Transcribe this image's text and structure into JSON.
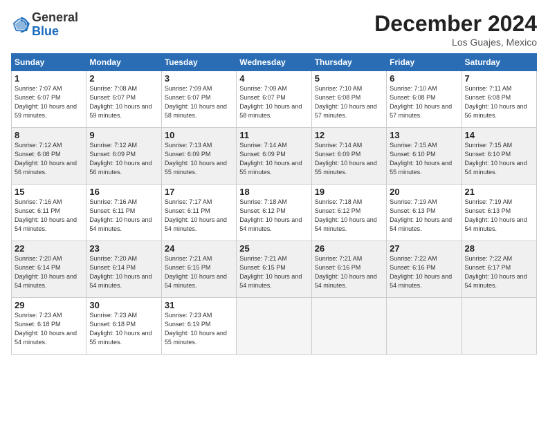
{
  "logo": {
    "general": "General",
    "blue": "Blue"
  },
  "title": "December 2024",
  "location": "Los Guajes, Mexico",
  "headers": [
    "Sunday",
    "Monday",
    "Tuesday",
    "Wednesday",
    "Thursday",
    "Friday",
    "Saturday"
  ],
  "weeks": [
    [
      {
        "day": "1",
        "sunrise": "7:07 AM",
        "sunset": "6:07 PM",
        "daylight": "10 hours and 59 minutes."
      },
      {
        "day": "2",
        "sunrise": "7:08 AM",
        "sunset": "6:07 PM",
        "daylight": "10 hours and 59 minutes."
      },
      {
        "day": "3",
        "sunrise": "7:09 AM",
        "sunset": "6:07 PM",
        "daylight": "10 hours and 58 minutes."
      },
      {
        "day": "4",
        "sunrise": "7:09 AM",
        "sunset": "6:07 PM",
        "daylight": "10 hours and 58 minutes."
      },
      {
        "day": "5",
        "sunrise": "7:10 AM",
        "sunset": "6:08 PM",
        "daylight": "10 hours and 57 minutes."
      },
      {
        "day": "6",
        "sunrise": "7:10 AM",
        "sunset": "6:08 PM",
        "daylight": "10 hours and 57 minutes."
      },
      {
        "day": "7",
        "sunrise": "7:11 AM",
        "sunset": "6:08 PM",
        "daylight": "10 hours and 56 minutes."
      }
    ],
    [
      {
        "day": "8",
        "sunrise": "7:12 AM",
        "sunset": "6:08 PM",
        "daylight": "10 hours and 56 minutes."
      },
      {
        "day": "9",
        "sunrise": "7:12 AM",
        "sunset": "6:09 PM",
        "daylight": "10 hours and 56 minutes."
      },
      {
        "day": "10",
        "sunrise": "7:13 AM",
        "sunset": "6:09 PM",
        "daylight": "10 hours and 55 minutes."
      },
      {
        "day": "11",
        "sunrise": "7:14 AM",
        "sunset": "6:09 PM",
        "daylight": "10 hours and 55 minutes."
      },
      {
        "day": "12",
        "sunrise": "7:14 AM",
        "sunset": "6:09 PM",
        "daylight": "10 hours and 55 minutes."
      },
      {
        "day": "13",
        "sunrise": "7:15 AM",
        "sunset": "6:10 PM",
        "daylight": "10 hours and 55 minutes."
      },
      {
        "day": "14",
        "sunrise": "7:15 AM",
        "sunset": "6:10 PM",
        "daylight": "10 hours and 54 minutes."
      }
    ],
    [
      {
        "day": "15",
        "sunrise": "7:16 AM",
        "sunset": "6:11 PM",
        "daylight": "10 hours and 54 minutes."
      },
      {
        "day": "16",
        "sunrise": "7:16 AM",
        "sunset": "6:11 PM",
        "daylight": "10 hours and 54 minutes."
      },
      {
        "day": "17",
        "sunrise": "7:17 AM",
        "sunset": "6:11 PM",
        "daylight": "10 hours and 54 minutes."
      },
      {
        "day": "18",
        "sunrise": "7:18 AM",
        "sunset": "6:12 PM",
        "daylight": "10 hours and 54 minutes."
      },
      {
        "day": "19",
        "sunrise": "7:18 AM",
        "sunset": "6:12 PM",
        "daylight": "10 hours and 54 minutes."
      },
      {
        "day": "20",
        "sunrise": "7:19 AM",
        "sunset": "6:13 PM",
        "daylight": "10 hours and 54 minutes."
      },
      {
        "day": "21",
        "sunrise": "7:19 AM",
        "sunset": "6:13 PM",
        "daylight": "10 hours and 54 minutes."
      }
    ],
    [
      {
        "day": "22",
        "sunrise": "7:20 AM",
        "sunset": "6:14 PM",
        "daylight": "10 hours and 54 minutes."
      },
      {
        "day": "23",
        "sunrise": "7:20 AM",
        "sunset": "6:14 PM",
        "daylight": "10 hours and 54 minutes."
      },
      {
        "day": "24",
        "sunrise": "7:21 AM",
        "sunset": "6:15 PM",
        "daylight": "10 hours and 54 minutes."
      },
      {
        "day": "25",
        "sunrise": "7:21 AM",
        "sunset": "6:15 PM",
        "daylight": "10 hours and 54 minutes."
      },
      {
        "day": "26",
        "sunrise": "7:21 AM",
        "sunset": "6:16 PM",
        "daylight": "10 hours and 54 minutes."
      },
      {
        "day": "27",
        "sunrise": "7:22 AM",
        "sunset": "6:16 PM",
        "daylight": "10 hours and 54 minutes."
      },
      {
        "day": "28",
        "sunrise": "7:22 AM",
        "sunset": "6:17 PM",
        "daylight": "10 hours and 54 minutes."
      }
    ],
    [
      {
        "day": "29",
        "sunrise": "7:23 AM",
        "sunset": "6:18 PM",
        "daylight": "10 hours and 54 minutes."
      },
      {
        "day": "30",
        "sunrise": "7:23 AM",
        "sunset": "6:18 PM",
        "daylight": "10 hours and 55 minutes."
      },
      {
        "day": "31",
        "sunrise": "7:23 AM",
        "sunset": "6:19 PM",
        "daylight": "10 hours and 55 minutes."
      },
      null,
      null,
      null,
      null
    ]
  ]
}
